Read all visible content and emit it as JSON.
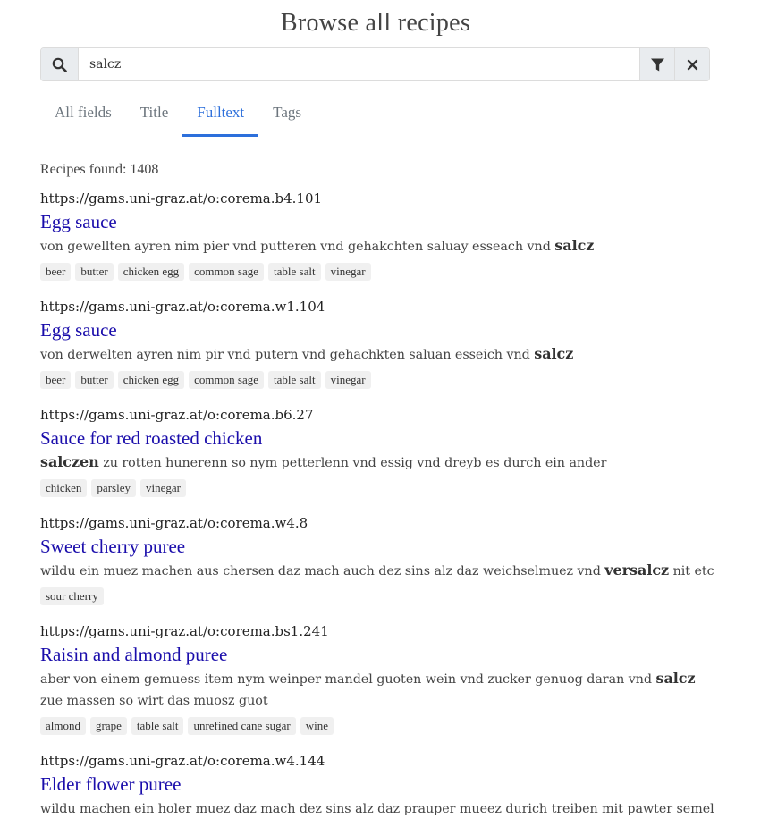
{
  "page": {
    "title": "Browse all recipes"
  },
  "search": {
    "value": "salcz",
    "search_icon": "search-icon",
    "filter_icon": "filter-icon",
    "clear_icon": "close-icon"
  },
  "tabs": [
    {
      "label": "All fields",
      "active": false
    },
    {
      "label": "Title",
      "active": false
    },
    {
      "label": "Fulltext",
      "active": true
    },
    {
      "label": "Tags",
      "active": false
    }
  ],
  "results_summary": {
    "label": "Recipes found: 1408"
  },
  "colors": {
    "accent": "#2c6fdb",
    "link": "#1a0dab"
  },
  "results": [
    {
      "url": "https://gams.uni-graz.at/o:corema.b4.101",
      "title": "Egg sauce",
      "snippet_before": "von gewellten ayren nim pier vnd putteren vnd gehakchten saluay esseach vnd ",
      "snippet_match": "salcz",
      "snippet_after": "",
      "tags": [
        "beer",
        "butter",
        "chicken egg",
        "common sage",
        "table salt",
        "vinegar"
      ]
    },
    {
      "url": "https://gams.uni-graz.at/o:corema.w1.104",
      "title": "Egg sauce",
      "snippet_before": "von derwelten ayren nim pir vnd putern vnd gehachkten saluan esseich vnd ",
      "snippet_match": "salcz",
      "snippet_after": "",
      "tags": [
        "beer",
        "butter",
        "chicken egg",
        "common sage",
        "table salt",
        "vinegar"
      ]
    },
    {
      "url": "https://gams.uni-graz.at/o:corema.b6.27",
      "title": "Sauce for red roasted chicken",
      "snippet_before": "",
      "snippet_match": "salczen",
      "snippet_after": " zu rotten hunerenn so nym petterlenn vnd essig vnd dreyb es durch ein ander",
      "tags": [
        "chicken",
        "parsley",
        "vinegar"
      ]
    },
    {
      "url": "https://gams.uni-graz.at/o:corema.w4.8",
      "title": "Sweet cherry puree",
      "snippet_before": "wildu ein muez machen aus chersen daz mach auch dez sins alz daz weichselmuez vnd ",
      "snippet_match": "versalcz",
      "snippet_after": " nit etc",
      "tags": [
        "sour cherry"
      ]
    },
    {
      "url": "https://gams.uni-graz.at/o:corema.bs1.241",
      "title": "Raisin and almond puree",
      "snippet_before": "aber von einem gemuess item nym weinper mandel guoten wein vnd zucker genuog daran vnd ",
      "snippet_match": "salcz",
      "snippet_after": " zue massen so wirt das muosz guot",
      "tags": [
        "almond",
        "grape",
        "table salt",
        "unrefined cane sugar",
        "wine"
      ]
    },
    {
      "url": "https://gams.uni-graz.at/o:corema.w4.144",
      "title": "Elder flower puree",
      "snippet_before": "wildu machen ein holer muez daz mach dez sins alz daz prauper mueez durich treiben mit pawter semel",
      "snippet_match": "",
      "snippet_after": "",
      "tags": []
    }
  ]
}
